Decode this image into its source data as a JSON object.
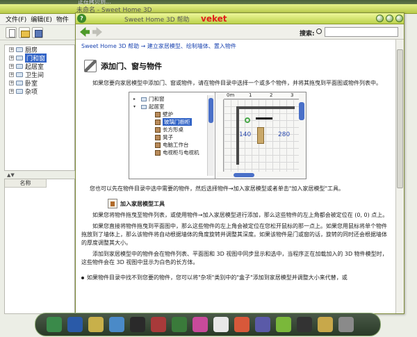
{
  "desktop": {
    "ghost_text": "正在拷贝到...",
    "watermark": "veket"
  },
  "app": {
    "title": "未命名 - Sweet Home 3D",
    "menu": [
      "文件(F)",
      "编辑(E)",
      "物件"
    ],
    "catalog": [
      {
        "label": "厨房",
        "selected": false
      },
      {
        "label": "门和窗",
        "selected": true
      },
      {
        "label": "起居室",
        "selected": false
      },
      {
        "label": "卫生间",
        "selected": false
      },
      {
        "label": "卧室",
        "selected": false
      },
      {
        "label": "杂项",
        "selected": false
      }
    ],
    "furniture_column": "名称"
  },
  "help": {
    "title": "Sweet Home 3D 帮助",
    "search_label": "搜索:",
    "search_value": "",
    "breadcrumb": "Sweet Home 3D 帮助 → 建立家居模型、绘制墙体、置入物件",
    "heading": "添加门、窗与物件",
    "intro": "如果您要向家居模型中添加门、窗或物件，请在物件目录中选择一个或多个物件，并将其拖曳到平面图或物件列表中。",
    "illustration": {
      "tree": [
        {
          "label": "门和窗",
          "kind": "folder",
          "tri": "▸"
        },
        {
          "label": "起居室",
          "kind": "folder",
          "tri": "▾"
        },
        {
          "label": "壁炉",
          "kind": "item",
          "tri": ""
        },
        {
          "label": "玻璃门橱柜",
          "kind": "item",
          "tri": "",
          "selected": true
        },
        {
          "label": "长方形桌",
          "kind": "item",
          "tri": ""
        },
        {
          "label": "凳子",
          "kind": "item",
          "tri": ""
        },
        {
          "label": "电脑工作台",
          "kind": "item",
          "tri": ""
        },
        {
          "label": "电视柜与电视机",
          "kind": "item",
          "tri": ""
        }
      ],
      "ruler_top": [
        "0m",
        "1",
        "2",
        "3"
      ],
      "dim1": "140",
      "dim2": "280"
    },
    "para1": "您也可以先在物件目录中选中需要的物件，然后选择物件→加入家居模型或者单击\"加入家居模型\"工具。",
    "add_label": "加入家居模型工具",
    "para2": "如果您将物件拖曳至物件列表，或使用物件→加入家居模型进行添加，那么这些物件的左上角都会被定位在 (0, 0) 点上。",
    "para3": "如果您直接将物件拖曳到平面图中，那么这些物件的左上角会被定位在您松开鼠标的那一点上。如果您用鼠标将单个物件拖放到了墙体上，那么该物件将自动根据墙体的角度旋转并调整其深度。如果该物件是门或窗的话，旋转的同时还会根据墙体的厚度调整其大小。",
    "para4": "添加到家居模型中的物件会在物件列表、平面图和 3D 视图中同步显示和选中，当程序正在加载加入的 3D 物件模型时，这些物件会在 3D 视图中显示为白色的长方体。",
    "bullet": "如果物件目录中找不到您要的物件，您可以将\"杂项\"类别中的\"盒子\"添加到家居模型并调整大小来代替，或"
  },
  "colors": {
    "accent": "#bcd24d",
    "link": "#1b44b0",
    "selection": "#3163c6"
  },
  "dock": [
    "chart-app",
    "monitor",
    "chat",
    "browser",
    "network",
    "media",
    "security",
    "music",
    "qq-penguin",
    "calendar",
    "notes",
    "photos",
    "terminal",
    "files",
    "trash"
  ]
}
